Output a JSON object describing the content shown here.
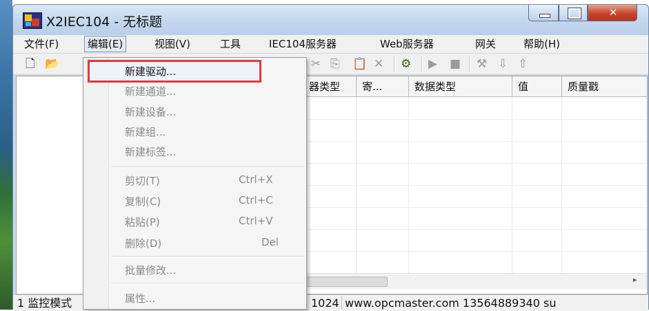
{
  "window": {
    "title": "X2IEC104 - 无标题"
  },
  "menubar": {
    "items": [
      "文件(F)",
      "编辑(E)",
      "视图(V)",
      "工具",
      "IEC104服务器",
      "Web服务器",
      "网关",
      "帮助(H)"
    ]
  },
  "toolbar": {
    "icons": [
      "new-icon",
      "open-icon",
      "cut-icon",
      "copy-icon",
      "paste-icon",
      "delete-icon",
      "driver-icon",
      "run-icon",
      "stop-icon",
      "tools-icon",
      "load-icon",
      "save-icon"
    ]
  },
  "table": {
    "columns": [
      "器类型",
      "寄...",
      "数据类型",
      "值",
      "质量戳"
    ]
  },
  "edit_menu": {
    "group1": [
      "新建驱动...",
      "新建通道...",
      "新建设备...",
      "新建组...",
      "新建标签..."
    ],
    "group2": [
      {
        "label": "剪切(T)",
        "shortcut": "Ctrl+X"
      },
      {
        "label": "复制(C)",
        "shortcut": "Ctrl+C"
      },
      {
        "label": "粘贴(P)",
        "shortcut": "Ctrl+V"
      },
      {
        "label": "删除(D)",
        "shortcut": "Del"
      }
    ],
    "batch": "批量修改...",
    "properties": "属性...",
    "highlight_color": "#e0383b"
  },
  "statusbar": {
    "left": "1 监控模式",
    "port": "1024",
    "info": "www.opcmaster.com 13564889340 su"
  }
}
